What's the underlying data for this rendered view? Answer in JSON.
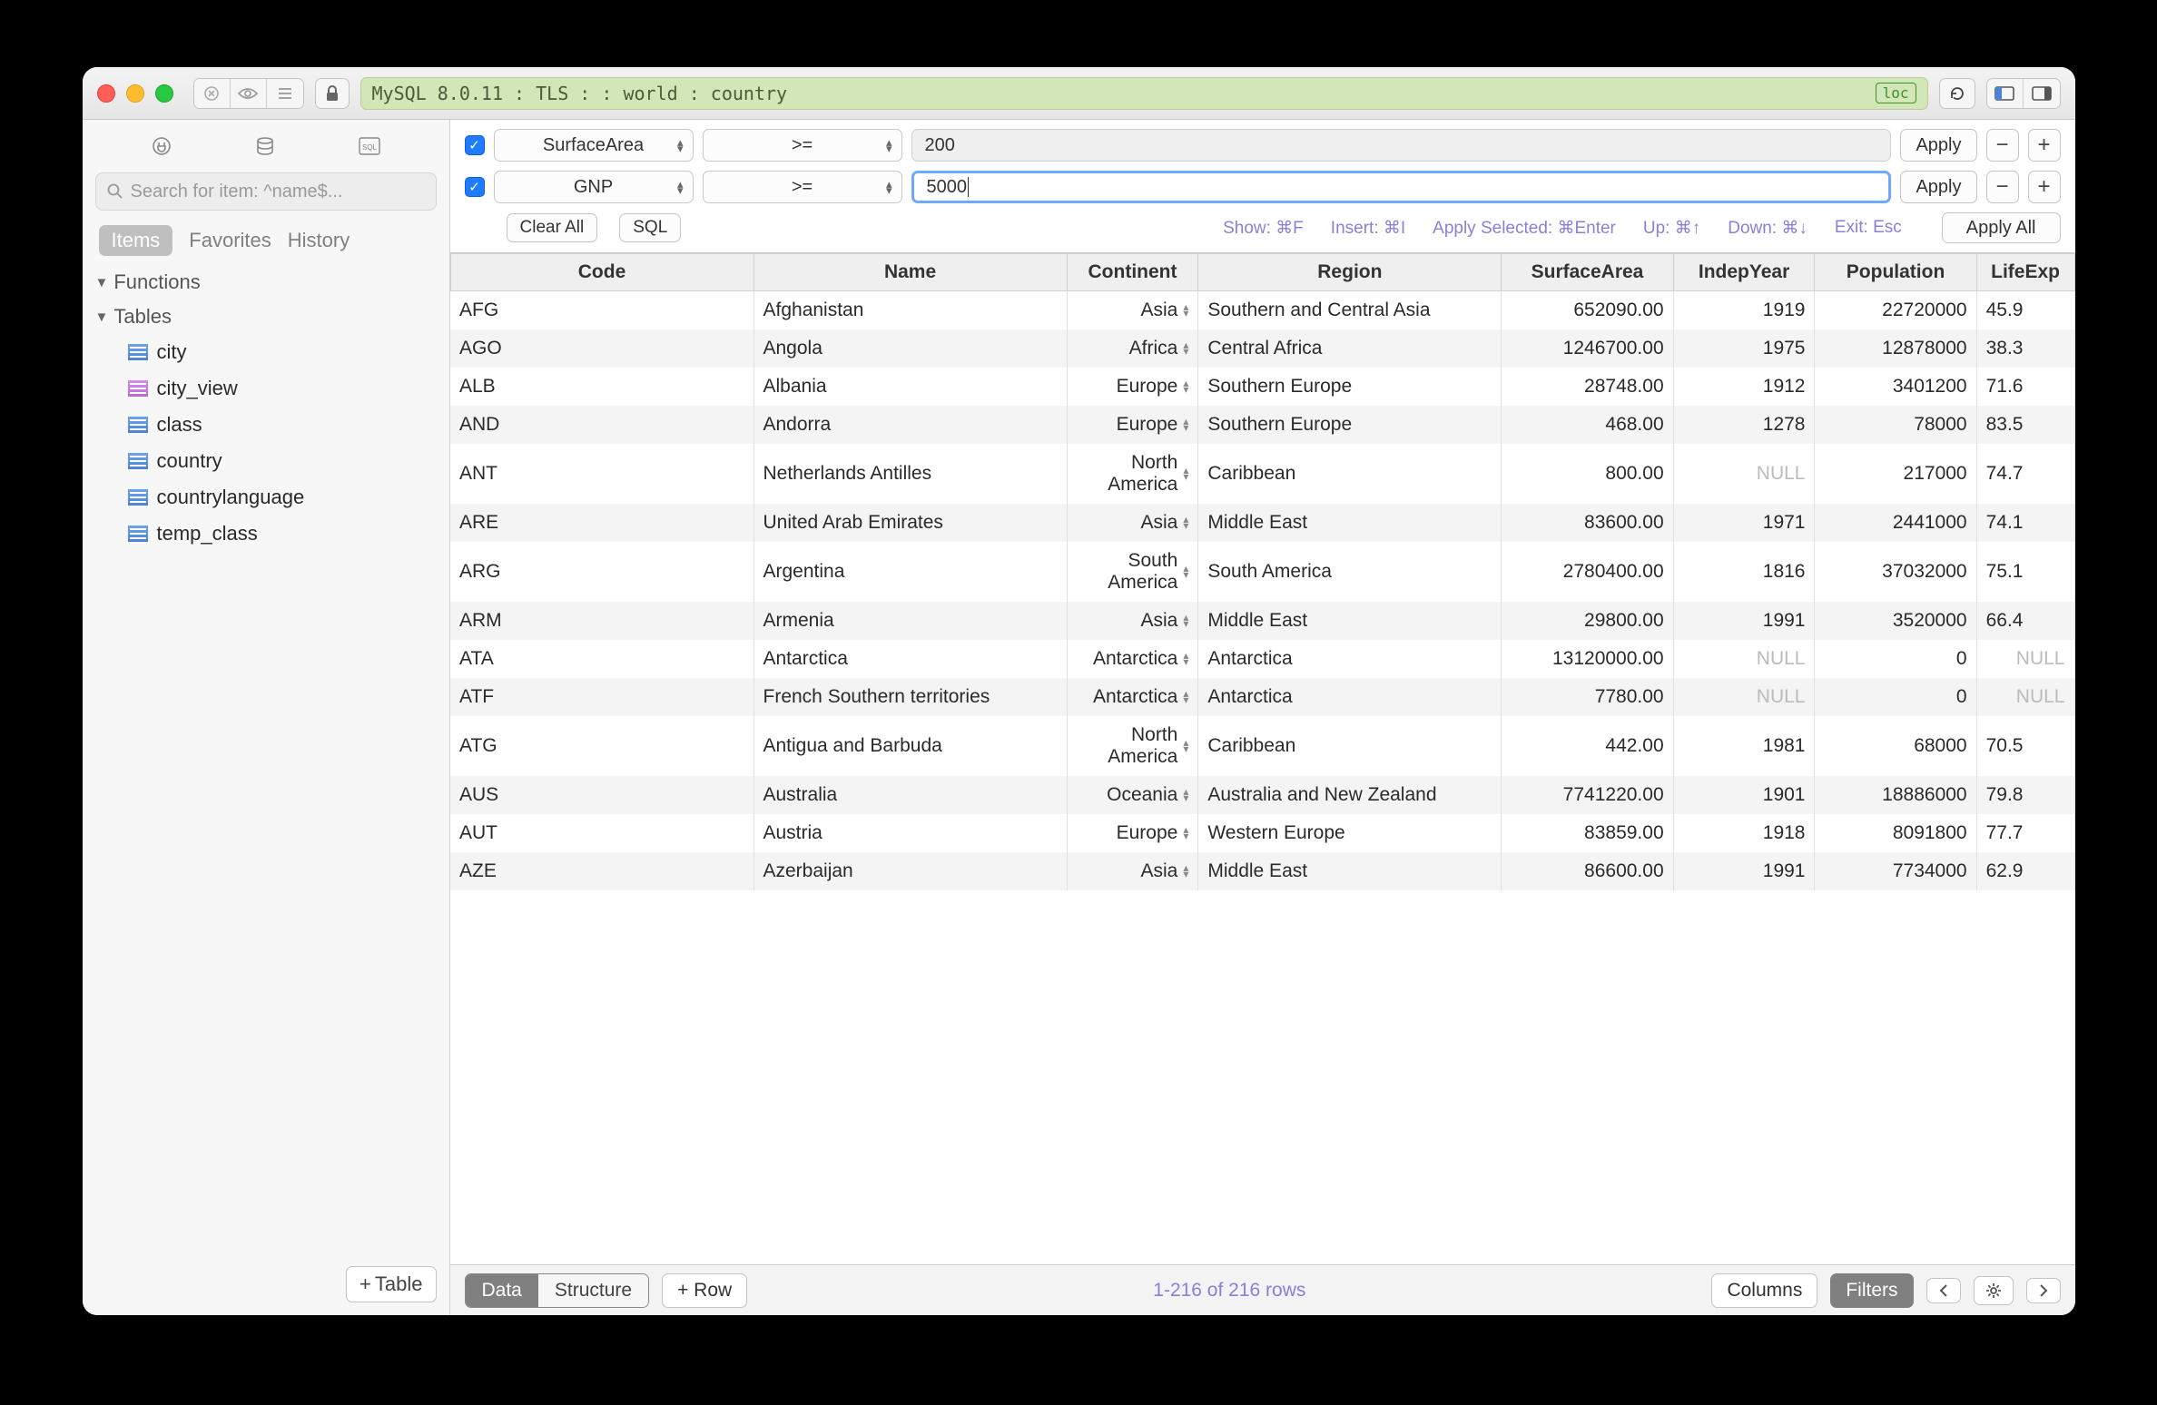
{
  "toolbar": {
    "connection_string": "MySQL 8.0.11 : TLS :  : world : country",
    "loc_badge": "loc"
  },
  "sidebar": {
    "search_placeholder": "Search for item: ^name$...",
    "tabs": {
      "items": "Items",
      "favorites": "Favorites",
      "history": "History"
    },
    "section_functions": "Functions",
    "section_tables": "Tables",
    "tables": [
      "city",
      "city_view",
      "class",
      "country",
      "countrylanguage",
      "temp_class"
    ],
    "add_table": "Table"
  },
  "filters": {
    "row1": {
      "column": "SurfaceArea",
      "op": ">=",
      "value": "200"
    },
    "row2": {
      "column": "GNP",
      "op": ">=",
      "value": "5000"
    },
    "apply": "Apply",
    "clear_all": "Clear All",
    "sql": "SQL",
    "apply_all": "Apply All",
    "hints": {
      "show": "Show: ⌘F",
      "insert": "Insert: ⌘I",
      "apply_selected": "Apply Selected: ⌘Enter",
      "up": "Up: ⌘↑",
      "down": "Down: ⌘↓",
      "exit": "Exit: Esc"
    }
  },
  "grid": {
    "columns": [
      "Code",
      "Name",
      "Continent",
      "Region",
      "SurfaceArea",
      "IndepYear",
      "Population",
      "LifeExp"
    ],
    "rows": [
      {
        "Code": "AFG",
        "Name": "Afghanistan",
        "Continent": "Asia",
        "Region": "Southern and Central Asia",
        "SurfaceArea": "652090.00",
        "IndepYear": "1919",
        "Population": "22720000",
        "LifeExp": "45.9"
      },
      {
        "Code": "AGO",
        "Name": "Angola",
        "Continent": "Africa",
        "Region": "Central Africa",
        "SurfaceArea": "1246700.00",
        "IndepYear": "1975",
        "Population": "12878000",
        "LifeExp": "38.3"
      },
      {
        "Code": "ALB",
        "Name": "Albania",
        "Continent": "Europe",
        "Region": "Southern Europe",
        "SurfaceArea": "28748.00",
        "IndepYear": "1912",
        "Population": "3401200",
        "LifeExp": "71.6"
      },
      {
        "Code": "AND",
        "Name": "Andorra",
        "Continent": "Europe",
        "Region": "Southern Europe",
        "SurfaceArea": "468.00",
        "IndepYear": "1278",
        "Population": "78000",
        "LifeExp": "83.5"
      },
      {
        "Code": "ANT",
        "Name": "Netherlands Antilles",
        "Continent": "North America",
        "Region": "Caribbean",
        "SurfaceArea": "800.00",
        "IndepYear": "NULL",
        "Population": "217000",
        "LifeExp": "74.7"
      },
      {
        "Code": "ARE",
        "Name": "United Arab Emirates",
        "Continent": "Asia",
        "Region": "Middle East",
        "SurfaceArea": "83600.00",
        "IndepYear": "1971",
        "Population": "2441000",
        "LifeExp": "74.1"
      },
      {
        "Code": "ARG",
        "Name": "Argentina",
        "Continent": "South America",
        "Region": "South America",
        "SurfaceArea": "2780400.00",
        "IndepYear": "1816",
        "Population": "37032000",
        "LifeExp": "75.1"
      },
      {
        "Code": "ARM",
        "Name": "Armenia",
        "Continent": "Asia",
        "Region": "Middle East",
        "SurfaceArea": "29800.00",
        "IndepYear": "1991",
        "Population": "3520000",
        "LifeExp": "66.4"
      },
      {
        "Code": "ATA",
        "Name": "Antarctica",
        "Continent": "Antarctica",
        "Region": "Antarctica",
        "SurfaceArea": "13120000.00",
        "IndepYear": "NULL",
        "Population": "0",
        "LifeExp": "NULL"
      },
      {
        "Code": "ATF",
        "Name": "French Southern territories",
        "Continent": "Antarctica",
        "Region": "Antarctica",
        "SurfaceArea": "7780.00",
        "IndepYear": "NULL",
        "Population": "0",
        "LifeExp": "NULL"
      },
      {
        "Code": "ATG",
        "Name": "Antigua and Barbuda",
        "Continent": "North America",
        "Region": "Caribbean",
        "SurfaceArea": "442.00",
        "IndepYear": "1981",
        "Population": "68000",
        "LifeExp": "70.5"
      },
      {
        "Code": "AUS",
        "Name": "Australia",
        "Continent": "Oceania",
        "Region": "Australia and New Zealand",
        "SurfaceArea": "7741220.00",
        "IndepYear": "1901",
        "Population": "18886000",
        "LifeExp": "79.8"
      },
      {
        "Code": "AUT",
        "Name": "Austria",
        "Continent": "Europe",
        "Region": "Western Europe",
        "SurfaceArea": "83859.00",
        "IndepYear": "1918",
        "Population": "8091800",
        "LifeExp": "77.7"
      },
      {
        "Code": "AZE",
        "Name": "Azerbaijan",
        "Continent": "Asia",
        "Region": "Middle East",
        "SurfaceArea": "86600.00",
        "IndepYear": "1991",
        "Population": "7734000",
        "LifeExp": "62.9"
      }
    ]
  },
  "footer": {
    "data": "Data",
    "structure": "Structure",
    "row": "Row",
    "rowinfo": "1-216 of 216 rows",
    "columns": "Columns",
    "filters": "Filters"
  }
}
